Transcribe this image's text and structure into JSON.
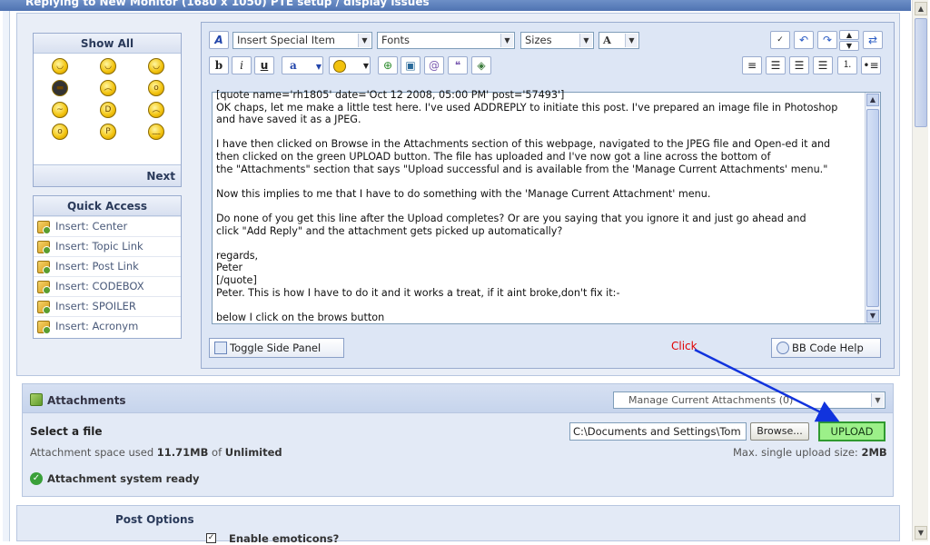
{
  "window": {
    "title": "Replying to New Monitor (1680 x 1050) PTE setup / display issues"
  },
  "smileys": {
    "show_all": "Show All",
    "next": "Next",
    "faces": [
      "smile",
      "wink",
      "grin",
      "cool",
      "angry",
      "shocked",
      "huh",
      "laugh",
      "sad",
      "surprised",
      "tongue",
      "undecided"
    ]
  },
  "quick_access": {
    "title": "Quick Access",
    "items": [
      "Insert: Center",
      "Insert: Topic Link",
      "Insert: Post Link",
      "Insert: CODEBOX",
      "Insert: SPOILER",
      "Insert: Acronym"
    ]
  },
  "toolbar": {
    "special_item": "Insert Special Item",
    "fonts": "Fonts",
    "sizes": "Sizes",
    "bold": "b",
    "italic": "i",
    "underline": "u",
    "font_color": "A",
    "text_color": "a"
  },
  "editor": {
    "content": "[quote name='rh1805' date='Oct 12 2008, 05:00 PM' post='57493']\nOK chaps, let me make a little test here. I've used ADDREPLY to initiate this post. I've prepared an image file in Photoshop\nand have saved it as a JPEG.\n\nI have then clicked on Browse in the Attachments section of this webpage, navigated to the JPEG file and Open-ed it and\nthen clicked on the green UPLOAD button. The file has uploaded and I've now got a line across the bottom of\nthe \"Attachments\" section that says \"Upload successful and is available from the 'Manage Current Attachments' menu.\"\n\nNow this implies to me that I have to do something with the 'Manage Current Attachment' menu.\n\nDo none of you get this line after the Upload completes? Or are you saying that you ignore it and just go ahead and\nclick \"Add Reply\" and the attachment gets picked up automatically?\n\nregards,\nPeter\n[/quote]\nPeter. This is how I have to do it and it works a treat, if it aint broke,don't fix it:-\n\nbelow I click on the brows button",
    "toggle_side_panel": "Toggle Side Panel",
    "bb_code_help": "BB Code Help",
    "annotation": "Click"
  },
  "attachments": {
    "title": "Attachments",
    "manage_select": "Manage Current Attachments (0)",
    "select_file": "Select a file",
    "file_path": "C:\\Documents and Settings\\Tom",
    "browse": "Browse...",
    "upload": "UPLOAD",
    "space_used_prefix": "Attachment space used",
    "space_used": "11.71MB",
    "of": "of",
    "space_limit": "Unlimited",
    "max_upload_prefix": "Max. single upload size:",
    "max_upload": "2MB",
    "status": "Attachment system ready"
  },
  "post_options": {
    "title": "Post Options",
    "enable_label": "Enable emoticons?"
  },
  "colors": {
    "panel": "#e9eef7",
    "upload_green": "#9cf089",
    "arrow_blue": "#1133dd",
    "click_red": "#e00000"
  }
}
